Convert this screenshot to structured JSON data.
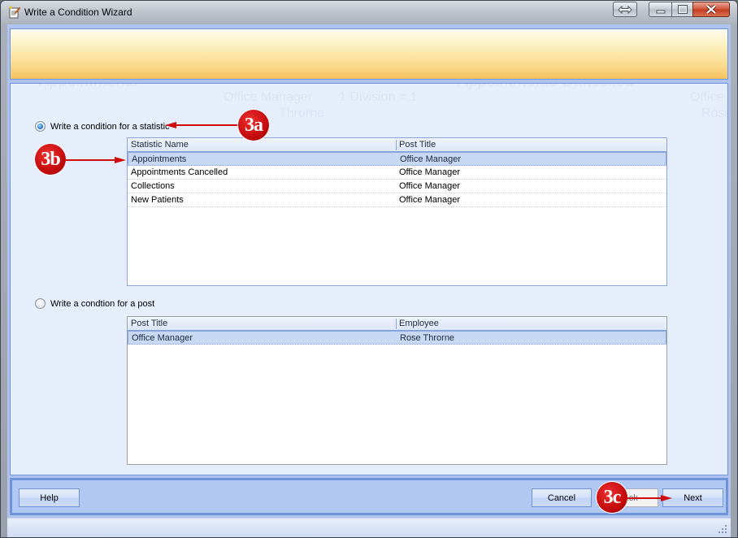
{
  "window": {
    "title": "Write a Condition Wizard",
    "icon": "edit-document-icon",
    "controls": [
      "restore-size-icon",
      "minimize-icon",
      "maximize-icon",
      "close-icon"
    ]
  },
  "background_ghost_text": {
    "stat1": "Appointments",
    "stat2": "Appointments Cancelled",
    "post1": "Office Manager",
    "employee1": "Throrne",
    "division": "1 Division = 1",
    "post2": "Office",
    "employee2": "Rose"
  },
  "statistic_option": {
    "label": "Write a condition for a statistic",
    "checked": true
  },
  "statistics_grid": {
    "columns": [
      "Statistic Name",
      "Post Title"
    ],
    "rows": [
      {
        "name": "Appointments",
        "post": "Office Manager",
        "selected": true
      },
      {
        "name": "Appointments Cancelled",
        "post": "Office Manager",
        "selected": false
      },
      {
        "name": "Collections",
        "post": "Office Manager",
        "selected": false
      },
      {
        "name": "New Patients",
        "post": "Office Manager",
        "selected": false
      }
    ]
  },
  "post_option": {
    "label": "Write a condtion for a post",
    "checked": false
  },
  "posts_grid": {
    "columns": [
      "Post Title",
      "Employee"
    ],
    "rows": [
      {
        "post": "Office Manager",
        "employee": "Rose Throrne",
        "selected": true
      }
    ]
  },
  "footer": {
    "help": "Help",
    "cancel": "Cancel",
    "back": "Back",
    "next": "Next"
  },
  "callouts": {
    "a": "3a",
    "b": "3b",
    "c": "3c"
  },
  "colors": {
    "callout": "#c40c0c",
    "selection": "#c7d8f3",
    "banner_bottom": "#f6c25e",
    "frame_blue": "#6f95d8"
  }
}
